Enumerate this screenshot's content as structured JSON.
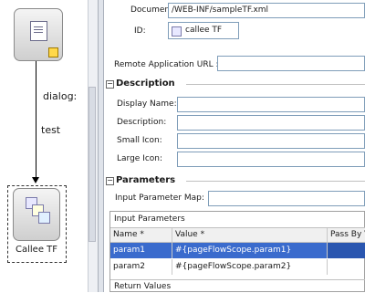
{
  "diagram": {
    "edge_label_dialog": "dialog:",
    "edge_label_test": "test",
    "callee_node_label": "Callee TF"
  },
  "properties": {
    "document_label": "Document:",
    "document_value": "/WEB-INF/sampleTF.xml",
    "id_label": "ID:",
    "id_value": "callee TF",
    "remote_url_label": "Remote Application URL :",
    "remote_url_value": "",
    "description_section": "Description",
    "display_name_label": "Display Name:",
    "description_label": "Description:",
    "small_icon_label": "Small Icon:",
    "large_icon_label": "Large Icon:",
    "parameters_section": "Parameters",
    "input_param_map_label": "Input Parameter Map:",
    "input_params_table": {
      "title": "Input Parameters",
      "columns": [
        "Name *",
        "Value *",
        "Pass By V"
      ],
      "rows": [
        {
          "name": "param1",
          "value": "#{pageFlowScope.param1}",
          "pass_by": "",
          "selected": true
        },
        {
          "name": "param2",
          "value": "#{pageFlowScope.param2}",
          "pass_by": "",
          "selected": false
        }
      ]
    },
    "return_values_label": "Return Values"
  }
}
